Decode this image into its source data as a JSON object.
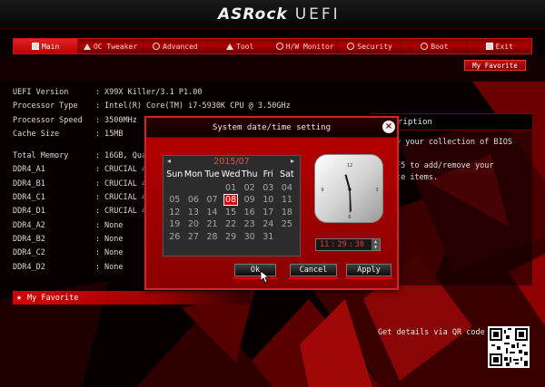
{
  "header": {
    "brand": "ASRock",
    "product": "UEFI"
  },
  "tabs": [
    {
      "label": "Main",
      "icon": "main-icon",
      "active": true
    },
    {
      "label": "OC Tweaker",
      "icon": "oc-tweaker-icon",
      "active": false
    },
    {
      "label": "Advanced",
      "icon": "advanced-icon",
      "active": false
    },
    {
      "label": "Tool",
      "icon": "tool-icon",
      "active": false
    },
    {
      "label": "H/W Monitor",
      "icon": "hw-monitor-icon",
      "active": false
    },
    {
      "label": "Security",
      "icon": "security-icon",
      "active": false
    },
    {
      "label": "Boot",
      "icon": "boot-icon",
      "active": false
    },
    {
      "label": "Exit",
      "icon": "exit-icon",
      "active": false
    }
  ],
  "my_favorite_button": "My Favorite",
  "info": [
    {
      "key": "UEFI Version",
      "value": "X99X Killer/3.1 P1.00"
    },
    {
      "key": "Processor Type",
      "value": "Intel(R) Core(TM) i7-5930K CPU @ 3.50GHz"
    },
    {
      "key": "Processor Speed",
      "value": "3500MHz"
    },
    {
      "key": "Cache Size",
      "value": "15MB"
    },
    {
      "key": "Total Memory",
      "value": "16GB, Quad"
    },
    {
      "key": "DDR4_A1",
      "value": "CRUCIAL 4G"
    },
    {
      "key": "DDR4_B1",
      "value": "CRUCIAL 4G"
    },
    {
      "key": "DDR4_C1",
      "value": "CRUCIAL 4G"
    },
    {
      "key": "DDR4_D1",
      "value": "CRUCIAL 4G"
    },
    {
      "key": "DDR4_A2",
      "value": "None"
    },
    {
      "key": "DDR4_B2",
      "value": "None"
    },
    {
      "key": "DDR4_C2",
      "value": "None"
    },
    {
      "key": "DDR4_D2",
      "value": "None"
    }
  ],
  "my_favorite_bar": "My Favorite",
  "description": {
    "title": "Description",
    "title_visible": "ription",
    "text": "y your collection of BIOS\n\nF5 to add/remove your\nte items."
  },
  "qr_label": "Get details via QR code",
  "dialog": {
    "title": "System date/time setting",
    "close_glyph": "×",
    "month": "2015/07",
    "days_of_week": [
      "Sun",
      "Mon",
      "Tue",
      "Wed",
      "Thu",
      "Fri",
      "Sat"
    ],
    "weeks": [
      [
        "",
        "",
        "",
        "01",
        "02",
        "03",
        "04"
      ],
      [
        "05",
        "06",
        "07",
        "08",
        "09",
        "10",
        "11"
      ],
      [
        "12",
        "13",
        "14",
        "15",
        "16",
        "17",
        "18"
      ],
      [
        "19",
        "20",
        "21",
        "22",
        "23",
        "24",
        "25"
      ],
      [
        "26",
        "27",
        "28",
        "29",
        "30",
        "31",
        ""
      ]
    ],
    "selected_day": "08",
    "time": {
      "h": "11",
      "m": "29",
      "s": "30"
    },
    "clock_numbers": [
      "12",
      "3",
      "6",
      "9"
    ],
    "buttons": {
      "ok": "Ok",
      "cancel": "Cancel",
      "apply": "Apply"
    }
  },
  "colors": {
    "accent": "#d40000",
    "selected_day": "#e00000",
    "month_text": "#e05050"
  }
}
